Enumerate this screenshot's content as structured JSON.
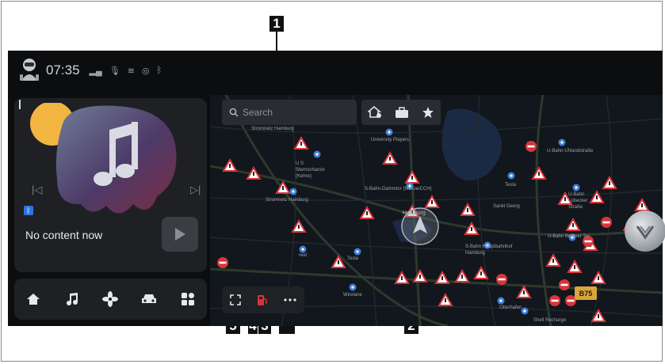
{
  "callouts": [
    "1",
    "2",
    "5",
    "4",
    "3"
  ],
  "status": {
    "time": "07:35"
  },
  "media": {
    "message": "No content now"
  },
  "search": {
    "placeholder": "Search"
  },
  "map_labels": [
    "University Players",
    "Stromnetz Hamburg",
    "U S Sternschanze (Kehre)",
    "S-Bahn-Dammtor (Messe/CCH)",
    "Stromnetz Hamburg",
    "Hamburg",
    "Tesla",
    "Sankt Georg",
    "U-Bahn-Uhlandstraße",
    "U-Bahn Lübecker Straße",
    "S-Bahn Hauptbahnhof Hamburg",
    "U-Bahn Berliner Tor",
    "Wirelane",
    "Oberhafen",
    "Shell Recharge",
    "Tesla",
    "reel"
  ],
  "road_badge": "B75",
  "colors": {
    "accent": "#d8343a",
    "screen_bg": "#0c0d0f",
    "panel": "#1f2024",
    "map_bg": "#12171d",
    "route": "#2b3a2c"
  }
}
